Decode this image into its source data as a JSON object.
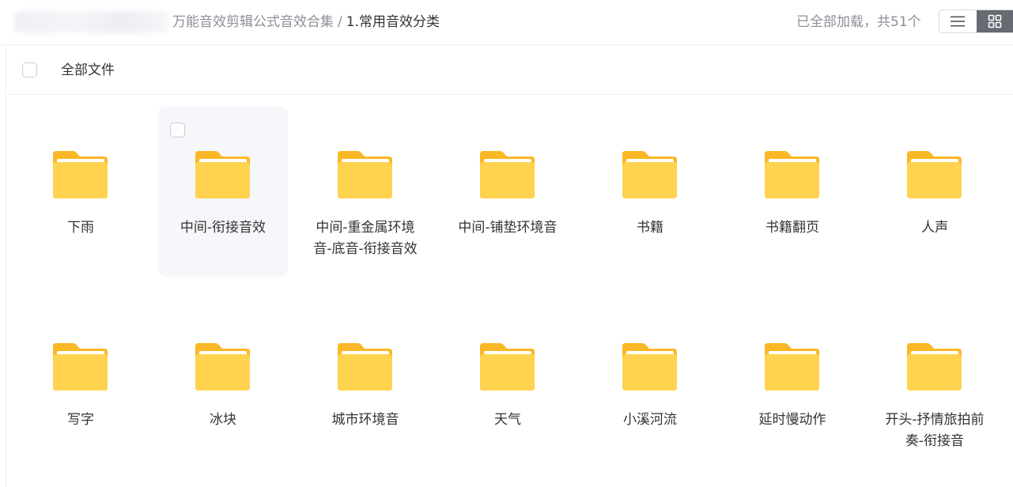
{
  "breadcrumb": {
    "parent": "万能音效剪辑公式音效合集",
    "separator": "/",
    "current": "1.常用音效分类"
  },
  "status": "已全部加载，共51个",
  "view_toggle": {
    "list_icon": "list-view-icon",
    "grid_icon": "grid-view-icon",
    "active": "grid"
  },
  "header": {
    "select_all_label": "全部文件"
  },
  "colors": {
    "folder_back": "#FBB826",
    "folder_front": "#FFD34F",
    "hover_tile": "#f6f7fb",
    "active_toggle": "#666a72"
  },
  "folders": [
    {
      "name": "下雨",
      "hovered": false
    },
    {
      "name": "中间-衔接音效",
      "hovered": true
    },
    {
      "name": "中间-重金属环境音-底音-衔接音效",
      "hovered": false
    },
    {
      "name": "中间-铺垫环境音",
      "hovered": false
    },
    {
      "name": "书籍",
      "hovered": false
    },
    {
      "name": "书籍翻页",
      "hovered": false
    },
    {
      "name": "人声",
      "hovered": false
    },
    {
      "name": "写字",
      "hovered": false
    },
    {
      "name": "冰块",
      "hovered": false
    },
    {
      "name": "城市环境音",
      "hovered": false
    },
    {
      "name": "天气",
      "hovered": false
    },
    {
      "name": "小溪河流",
      "hovered": false
    },
    {
      "name": "延时慢动作",
      "hovered": false
    },
    {
      "name": "开头-抒情旅拍前奏-衔接音",
      "hovered": false
    }
  ]
}
